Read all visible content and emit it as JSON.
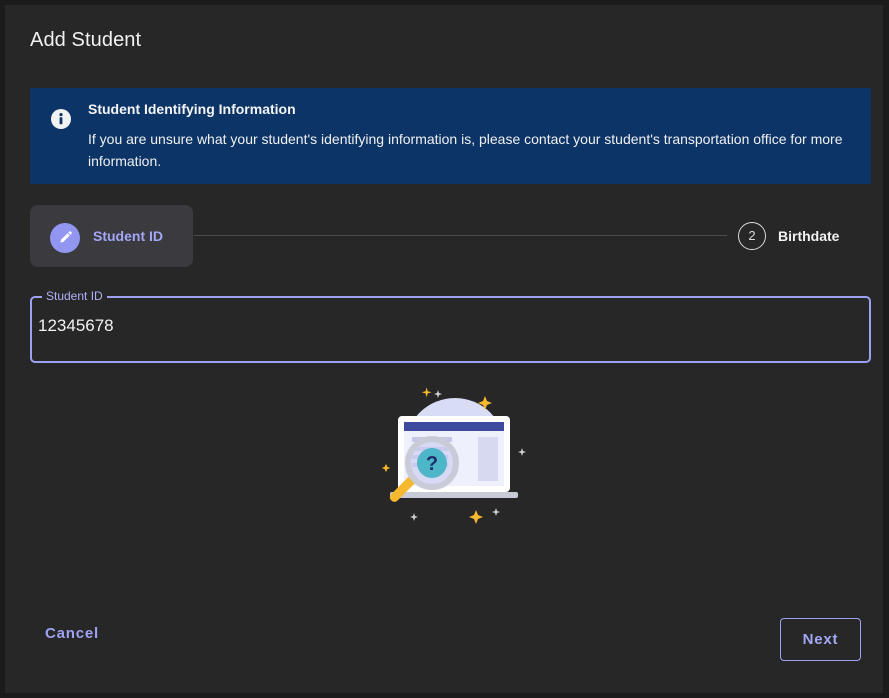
{
  "dialog": {
    "title": "Add Student"
  },
  "info": {
    "icon": "info-icon",
    "heading": "Student Identifying Information",
    "body": "If you are unsure what your student's identifying information is, please contact your student's transportation office for more information."
  },
  "stepper": {
    "steps": [
      {
        "label": "Student ID",
        "state": "active",
        "icon": "pencil-icon"
      },
      {
        "label": "Birthdate",
        "state": "pending",
        "number": "2"
      }
    ]
  },
  "student_id_field": {
    "label": "Student ID",
    "value": "12345678"
  },
  "illustration": {
    "icon": "laptop-search-illustration"
  },
  "actions": {
    "cancel_label": "Cancel",
    "next_label": "Next"
  },
  "colors": {
    "dialog_bg": "#272727",
    "info_banner_bg": "#0c3466",
    "accent": "#9da0f3",
    "illustration_gold": "#f5b82e"
  }
}
